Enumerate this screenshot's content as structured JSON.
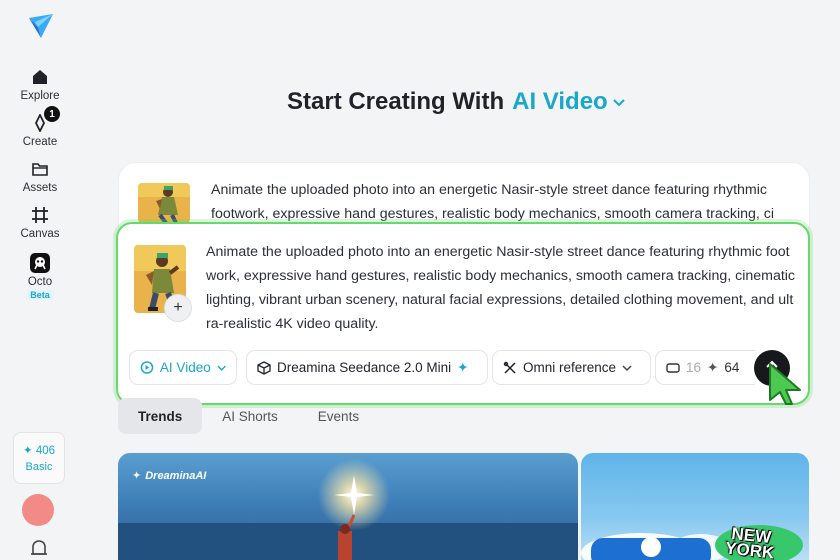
{
  "sidebar": {
    "items": [
      {
        "label": "Explore",
        "icon": "home-icon"
      },
      {
        "label": "Create",
        "icon": "create-icon",
        "badge": "1"
      },
      {
        "label": "Assets",
        "icon": "folder-icon"
      },
      {
        "label": "Canvas",
        "icon": "canvas-icon"
      },
      {
        "label": "Octo",
        "icon": "octo-icon",
        "tag": "Beta"
      }
    ],
    "credits": "406",
    "plan": "Basic"
  },
  "header": {
    "title": "Start Creating With",
    "mode": "AI Video"
  },
  "prompt_background": {
    "text": "Animate the uploaded photo into an energetic Nasir-style street dance featuring rhythmic footwork, expressive hand gestures, realistic body mechanics, smooth camera tracking, ci"
  },
  "prompt": {
    "text": "Animate the uploaded photo into an energetic Nasir-style street dance featuring rhythmic footwork, expressive hand gestures, realistic body mechanics, smooth camera tracking, cinematic lighting, vibrant urban scenery, natural facial expressions, detailed clothing movement, and ultra-realistic 4K video quality.",
    "add_symbol": "+"
  },
  "toolbar": {
    "type_label": "AI Video",
    "model_label": "Dreamina Seedance 2.0 Mini",
    "reference_label": "Omni reference",
    "ratio_label": "16",
    "cost_label": "64"
  },
  "tabs": [
    "Trends",
    "AI Shorts",
    "Events"
  ],
  "gallery": {
    "watermark": "DreaminaAI",
    "ny_text_1": "NEW",
    "ny_text_2": "YORK"
  },
  "colors": {
    "accent": "#1aa7c9",
    "highlight_border": "#66d96a",
    "avatar": "#f28b88"
  }
}
